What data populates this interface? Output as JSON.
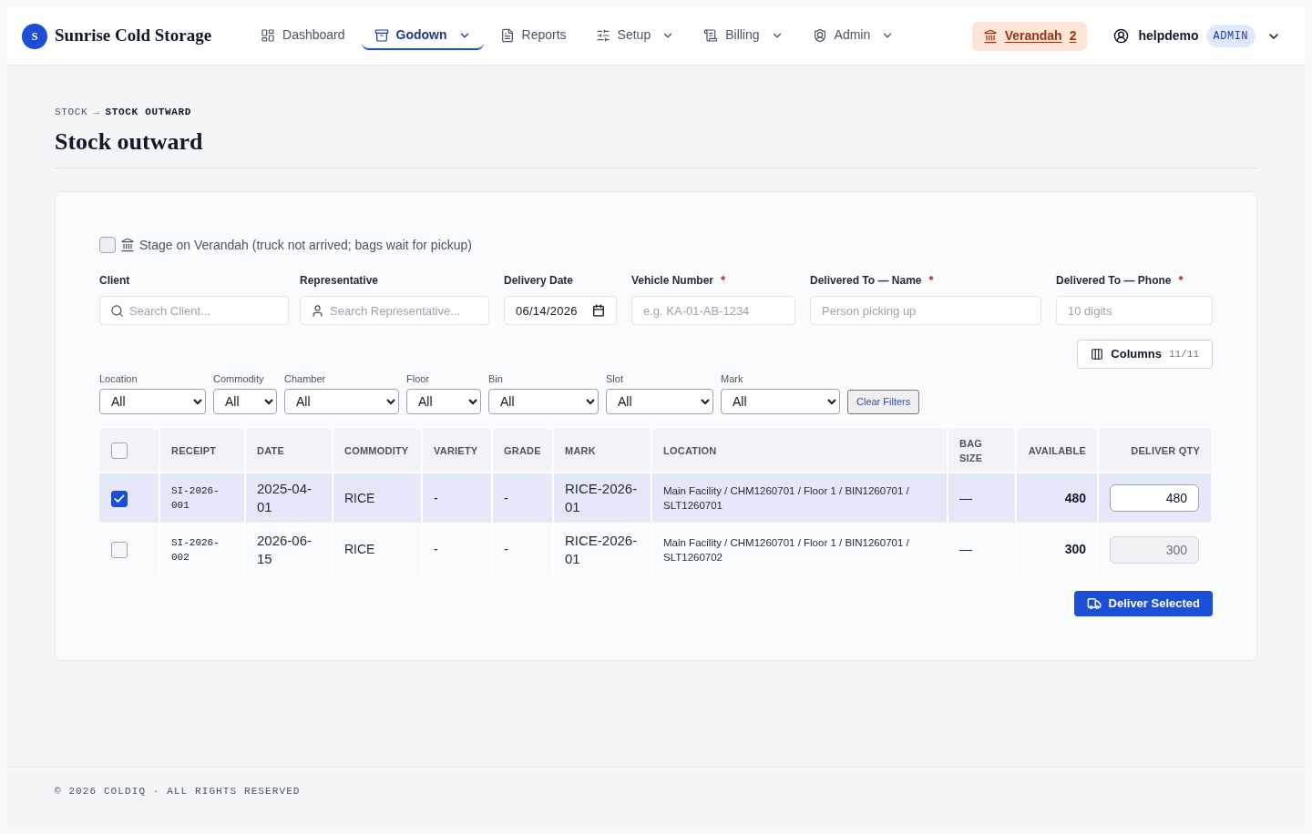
{
  "brand": {
    "initial": "S",
    "name": "Sunrise Cold Storage"
  },
  "nav": [
    {
      "label": "Dashboard",
      "selected": false,
      "menu": false
    },
    {
      "label": "Godown",
      "selected": true,
      "menu": true
    },
    {
      "label": "Reports",
      "selected": false,
      "menu": false
    },
    {
      "label": "Setup",
      "selected": false,
      "menu": true
    },
    {
      "label": "Billing",
      "selected": false,
      "menu": true
    },
    {
      "label": "Admin",
      "selected": false,
      "menu": true
    }
  ],
  "verandah": {
    "label": "Verandah",
    "count": "2"
  },
  "user": {
    "name": "helpdemo",
    "role": "ADMIN"
  },
  "breadcrumb": {
    "items": [
      "STOCK",
      "STOCK OUTWARD"
    ],
    "separator": "→"
  },
  "title": "Stock outward",
  "stage_option": {
    "label": "Stage on Verandah (truck not arrived; bags wait for pickup)",
    "checked": false
  },
  "fields": [
    {
      "kind": "search",
      "label": "Client",
      "placeholder": "Search Client..."
    },
    {
      "kind": "person",
      "label": "Representative",
      "placeholder": "Search Representative..."
    },
    {
      "kind": "date",
      "label": "Delivery Date",
      "value": "06/14/2026"
    },
    {
      "kind": "text",
      "label": "Vehicle Number",
      "required_mark": "*",
      "placeholder": "e.g. KA-01-AB-1234"
    },
    {
      "kind": "text",
      "label": "Delivered To — Name",
      "required_mark": "*",
      "placeholder": "Person picking up"
    },
    {
      "kind": "text",
      "label": "Delivered To — Phone",
      "required_mark": "*",
      "placeholder": "10 digits"
    }
  ],
  "columns_button": {
    "label": "Columns",
    "count": "11/11"
  },
  "filters": [
    {
      "label": "Location",
      "value": "All"
    },
    {
      "label": "Commodity",
      "value": "All"
    },
    {
      "label": "Chamber",
      "value": "All"
    },
    {
      "label": "Floor",
      "value": "All"
    },
    {
      "label": "Bin",
      "value": "All"
    },
    {
      "label": "Slot",
      "value": "All"
    },
    {
      "label": "Mark",
      "value": "All"
    }
  ],
  "clear_filters": "Clear Filters",
  "table": {
    "all_selected": false,
    "columns": [
      "RECEIPT",
      "DATE",
      "COMMODITY",
      "VARIETY",
      "GRADE",
      "MARK",
      "LOCATION",
      "BAG SIZE",
      "AVAILABLE",
      "DELIVER QTY"
    ],
    "rows": [
      {
        "selected": true,
        "receipt": "SI-2026-001",
        "date": "2025-04-01",
        "commodity": "RICE",
        "variety": "-",
        "grade": "-",
        "mark": "RICE-2026-01",
        "location": "Main Facility / CHM1260701 / Floor 1 / BIN1260701 / SLT1260701",
        "bag_size": "—",
        "available": "480",
        "deliver_qty": "480"
      },
      {
        "selected": false,
        "receipt": "SI-2026-002",
        "date": "2026-06-15",
        "commodity": "RICE",
        "variety": "-",
        "grade": "-",
        "mark": "RICE-2026-01",
        "location": "Main Facility / CHM1260701 / Floor 1 / BIN1260701 / SLT1260702",
        "bag_size": "—",
        "available": "300",
        "deliver_qty": "300"
      }
    ]
  },
  "deliver_button": "Deliver Selected",
  "footer": "© 2026 COLDIQ · ALL RIGHTS RESERVED"
}
